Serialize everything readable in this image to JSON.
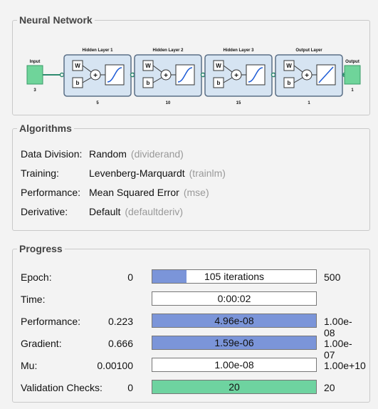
{
  "neural_network": {
    "title": "Neural Network",
    "input": {
      "label": "Input",
      "size": "3"
    },
    "layers": [
      {
        "name": "Hidden Layer 1",
        "size": "5",
        "activation": "tansig"
      },
      {
        "name": "Hidden Layer 2",
        "size": "10",
        "activation": "tansig"
      },
      {
        "name": "Hidden Layer 3",
        "size": "15",
        "activation": "tansig"
      },
      {
        "name": "Output Layer",
        "size": "1",
        "activation": "purelin"
      }
    ],
    "output": {
      "label": "Output",
      "size": "1"
    },
    "weight_label": "W",
    "bias_label": "b",
    "sum_label": "+"
  },
  "algorithms": {
    "title": "Algorithms",
    "rows": [
      {
        "label": "Data Division:",
        "value": "Random",
        "fn": "(dividerand)"
      },
      {
        "label": "Training:",
        "value": "Levenberg-Marquardt",
        "fn": "(trainlm)"
      },
      {
        "label": "Performance:",
        "value": "Mean Squared Error",
        "fn": "(mse)"
      },
      {
        "label": "Derivative:",
        "value": "Default",
        "fn": "(defaultderiv)"
      }
    ]
  },
  "progress": {
    "title": "Progress",
    "rows": [
      {
        "label": "Epoch:",
        "start": "0",
        "current": "105 iterations",
        "end": "500",
        "fill": 0.21,
        "color": "#7b95d9"
      },
      {
        "label": "Time:",
        "start": "",
        "current": "0:00:02",
        "end": "",
        "fill": 0,
        "color": "#7b95d9"
      },
      {
        "label": "Performance:",
        "start": "0.223",
        "current": "4.96e-08",
        "end": "1.00e-08",
        "fill": 1.0,
        "color": "#7b95d9"
      },
      {
        "label": "Gradient:",
        "start": "0.666",
        "current": "1.59e-06",
        "end": "1.00e-07",
        "fill": 1.0,
        "color": "#7b95d9"
      },
      {
        "label": "Mu:",
        "start": "0.00100",
        "current": "1.00e-08",
        "end": "1.00e+10",
        "fill": 0,
        "color": "#7b95d9"
      },
      {
        "label": "Validation Checks:",
        "start": "0",
        "current": "20",
        "end": "20",
        "fill": 1.0,
        "color": "#6ed3a0"
      }
    ]
  },
  "colors": {
    "io_box": "#6fd49a",
    "layer_fill": "#d6e4f2",
    "layer_border": "#5b6f86",
    "wire": "#2e8b6f",
    "progress_blue": "#7b95d9",
    "progress_green": "#6ed3a0"
  }
}
